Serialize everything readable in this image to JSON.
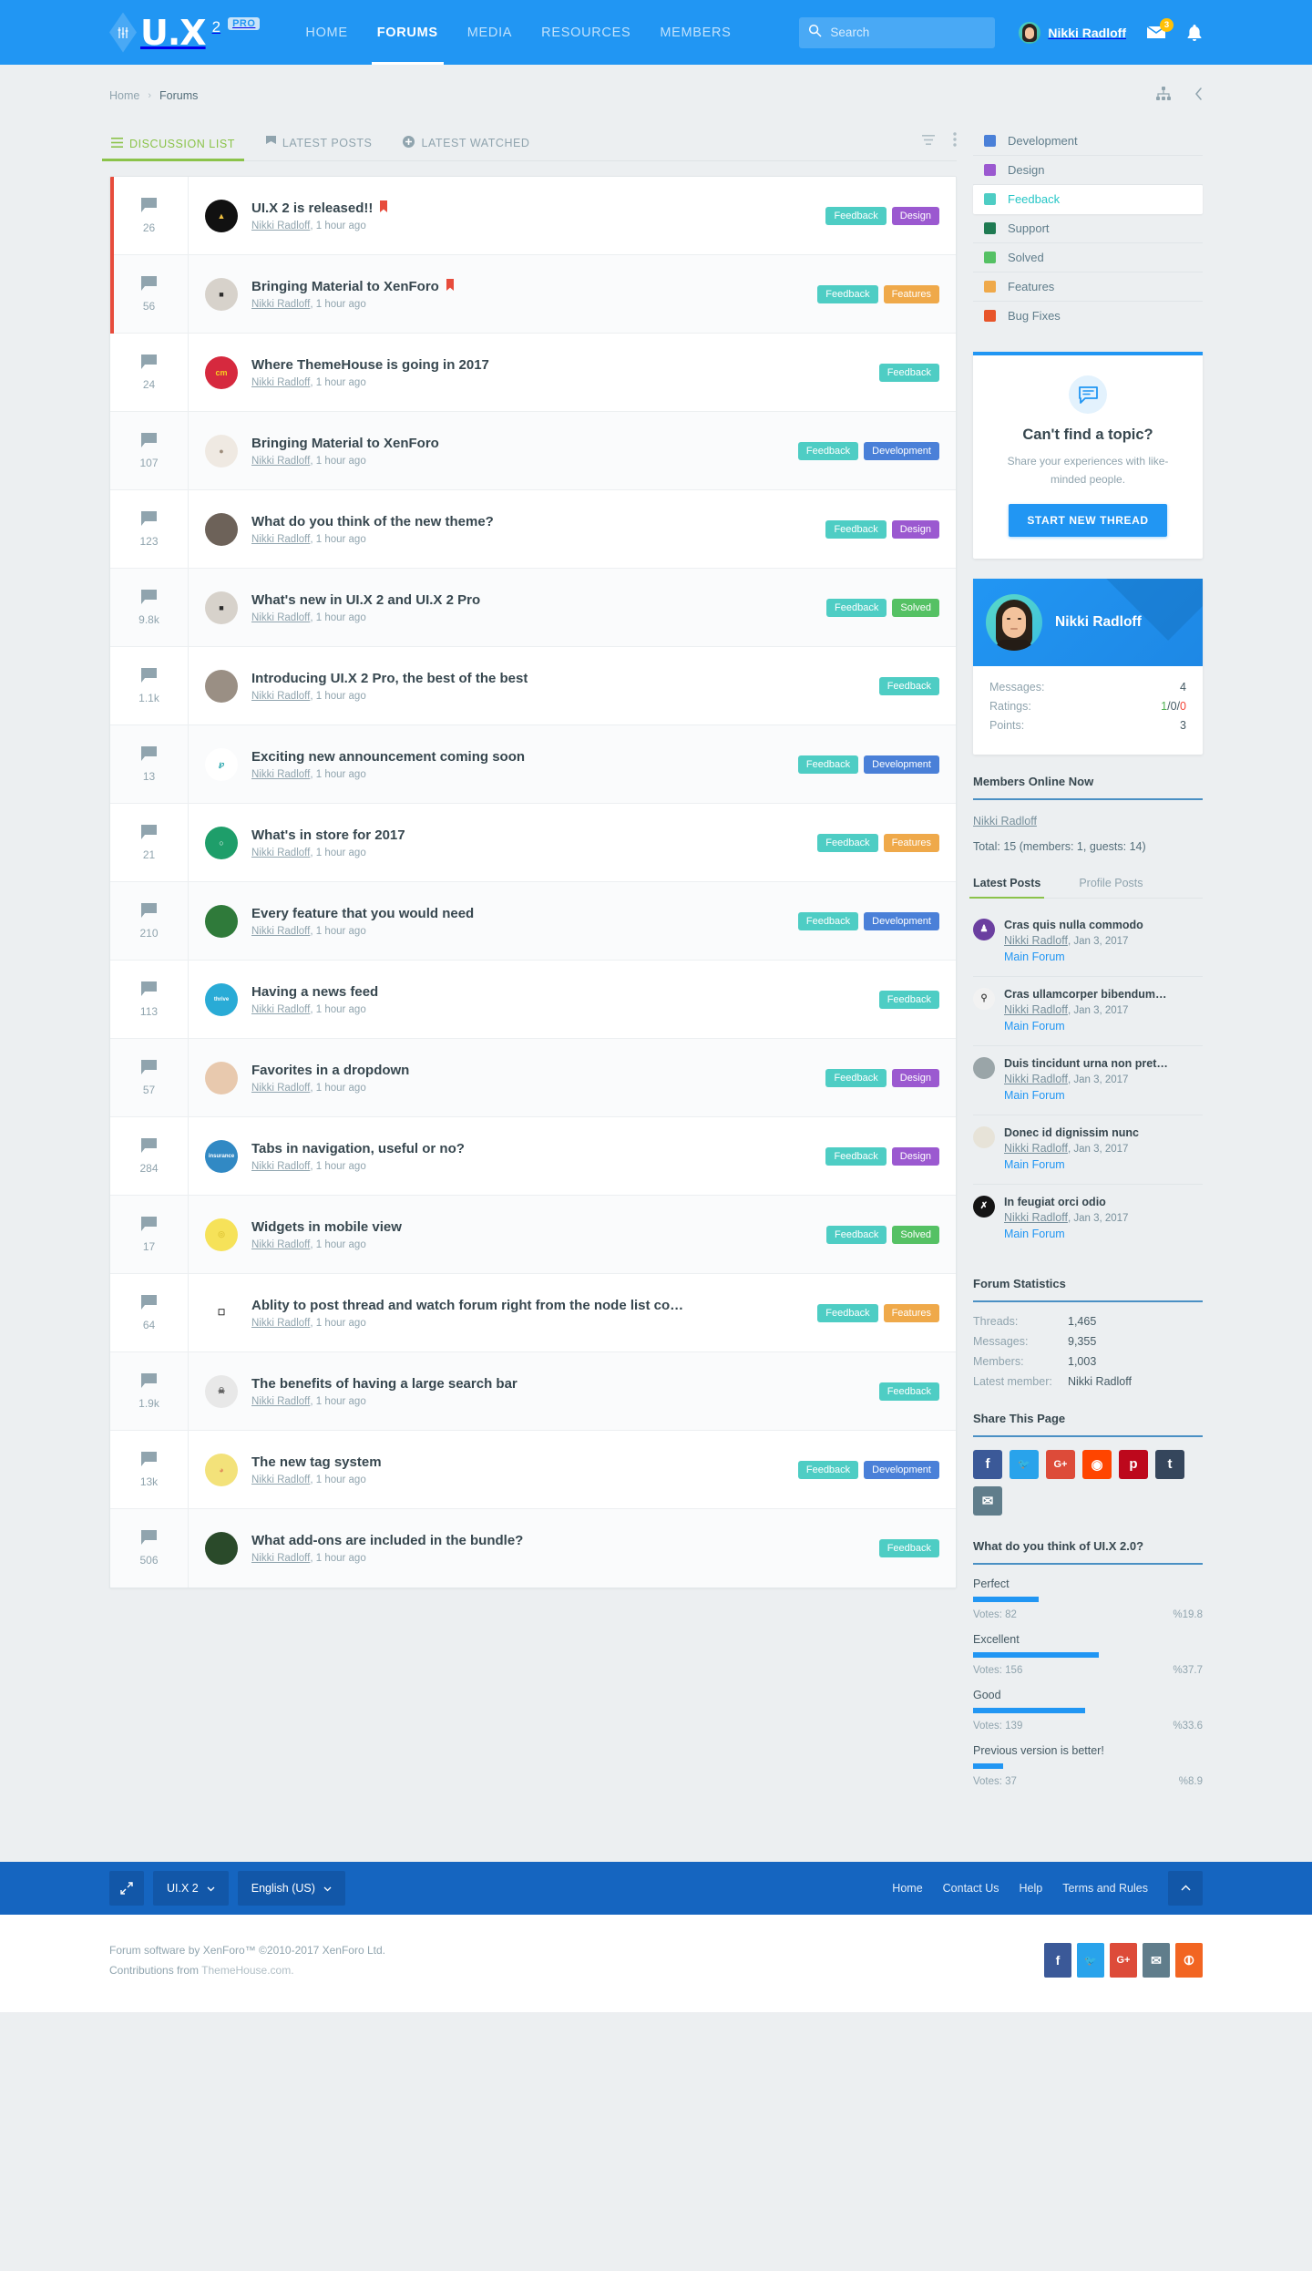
{
  "header": {
    "logo_text": "U.X",
    "logo_version": "2",
    "logo_badge": "PRO",
    "nav": [
      {
        "label": "HOME",
        "active": false
      },
      {
        "label": "FORUMS",
        "active": true
      },
      {
        "label": "MEDIA",
        "active": false
      },
      {
        "label": "RESOURCES",
        "active": false
      },
      {
        "label": "MEMBERS",
        "active": false
      }
    ],
    "search_placeholder": "Search",
    "search_value": "",
    "username": "Nikki Radloff",
    "inbox_badge": "3"
  },
  "breadcrumb": {
    "home": "Home",
    "separator": "›",
    "current": "Forums"
  },
  "tabs": [
    {
      "label": "DISCUSSION LIST",
      "icon": "list-icon",
      "active": true
    },
    {
      "label": "LATEST POSTS",
      "icon": "flag-icon",
      "active": false
    },
    {
      "label": "LATEST WATCHED",
      "icon": "plus-circle-icon",
      "active": false
    }
  ],
  "threads": [
    {
      "count": "26",
      "title": "UI.X 2 is released!!",
      "author": "Nikki Radloff",
      "time": "1 hour ago",
      "sticky": true,
      "pinned": true,
      "tags": [
        {
          "label": "Feedback",
          "color": "#4ecdc4"
        },
        {
          "label": "Design",
          "color": "#9b59d0"
        }
      ],
      "avatar": {
        "bg": "#111111",
        "fg": "#f0c040",
        "letter": "▲"
      }
    },
    {
      "count": "56",
      "title": "Bringing Material to XenForo",
      "author": "Nikki Radloff",
      "time": "1 hour ago",
      "sticky": true,
      "pinned": true,
      "tags": [
        {
          "label": "Feedback",
          "color": "#4ecdc4"
        },
        {
          "label": "Features",
          "color": "#efa94a"
        }
      ],
      "avatar": {
        "bg": "#d7d2cb",
        "fg": "#2b2b2b",
        "letter": "■"
      }
    },
    {
      "count": "24",
      "title": "Where ThemeHouse is going in 2017",
      "author": "Nikki Radloff",
      "time": "1 hour ago",
      "sticky": false,
      "pinned": false,
      "tags": [
        {
          "label": "Feedback",
          "color": "#4ecdc4"
        }
      ],
      "avatar": {
        "bg": "#d6293e",
        "fg": "#f5d020",
        "letter": "cm"
      }
    },
    {
      "count": "107",
      "title": "Bringing Material to XenForo",
      "author": "Nikki Radloff",
      "time": "1 hour ago",
      "sticky": false,
      "pinned": false,
      "tags": [
        {
          "label": "Feedback",
          "color": "#4ecdc4"
        },
        {
          "label": "Development",
          "color": "#4a80d8"
        }
      ],
      "avatar": {
        "bg": "#efe9e2",
        "fg": "#9e8d7c",
        "letter": "●"
      }
    },
    {
      "count": "123",
      "title": "What do you think of the new theme?",
      "author": "Nikki Radloff",
      "time": "1 hour ago",
      "sticky": false,
      "pinned": false,
      "tags": [
        {
          "label": "Feedback",
          "color": "#4ecdc4"
        },
        {
          "label": "Design",
          "color": "#9b59d0"
        }
      ],
      "avatar": {
        "bg": "#6d6259",
        "fg": "#ffffff",
        "letter": ""
      }
    },
    {
      "count": "9.8k",
      "title": "What's new in UI.X 2 and UI.X 2 Pro",
      "author": "Nikki Radloff",
      "time": "1 hour ago",
      "sticky": false,
      "pinned": false,
      "tags": [
        {
          "label": "Feedback",
          "color": "#4ecdc4"
        },
        {
          "label": "Solved",
          "color": "#55c164"
        }
      ],
      "avatar": {
        "bg": "#d7d2cb",
        "fg": "#2b2b2b",
        "letter": "■"
      }
    },
    {
      "count": "1.1k",
      "title": "Introducing UI.X 2 Pro, the best of the best",
      "author": "Nikki Radloff",
      "time": "1 hour ago",
      "sticky": false,
      "pinned": false,
      "tags": [
        {
          "label": "Feedback",
          "color": "#4ecdc4"
        }
      ],
      "avatar": {
        "bg": "#9a8f84",
        "fg": "#3a3129",
        "letter": ""
      }
    },
    {
      "count": "13",
      "title": "Exciting new announcement coming soon",
      "author": "Nikki Radloff",
      "time": "1 hour ago",
      "sticky": false,
      "pinned": false,
      "tags": [
        {
          "label": "Feedback",
          "color": "#4ecdc4"
        },
        {
          "label": "Development",
          "color": "#4a80d8"
        }
      ],
      "avatar": {
        "bg": "#ffffff",
        "fg": "#1ba0a8",
        "letter": "℘"
      }
    },
    {
      "count": "21",
      "title": "What's in store for 2017",
      "author": "Nikki Radloff",
      "time": "1 hour ago",
      "sticky": false,
      "pinned": false,
      "tags": [
        {
          "label": "Feedback",
          "color": "#4ecdc4"
        },
        {
          "label": "Features",
          "color": "#efa94a"
        }
      ],
      "avatar": {
        "bg": "#1e9e6a",
        "fg": "#ffffff",
        "letter": "○"
      }
    },
    {
      "count": "210",
      "title": "Every feature that you would need",
      "author": "Nikki Radloff",
      "time": "1 hour ago",
      "sticky": false,
      "pinned": false,
      "tags": [
        {
          "label": "Feedback",
          "color": "#4ecdc4"
        },
        {
          "label": "Development",
          "color": "#4a80d8"
        }
      ],
      "avatar": {
        "bg": "#2f7a3a",
        "fg": "#e8d24a",
        "letter": ""
      }
    },
    {
      "count": "113",
      "title": "Having a news feed",
      "author": "Nikki Radloff",
      "time": "1 hour ago",
      "sticky": false,
      "pinned": false,
      "tags": [
        {
          "label": "Feedback",
          "color": "#4ecdc4"
        }
      ],
      "avatar": {
        "bg": "#29abd6",
        "fg": "#ffffff",
        "letter": "thrive"
      }
    },
    {
      "count": "57",
      "title": "Favorites in a dropdown",
      "author": "Nikki Radloff",
      "time": "1 hour ago",
      "sticky": false,
      "pinned": false,
      "tags": [
        {
          "label": "Feedback",
          "color": "#4ecdc4"
        },
        {
          "label": "Design",
          "color": "#9b59d0"
        }
      ],
      "avatar": {
        "bg": "#e8c9ae",
        "fg": "#6b4a33",
        "letter": ""
      }
    },
    {
      "count": "284",
      "title": "Tabs in navigation, useful or no?",
      "author": "Nikki Radloff",
      "time": "1 hour ago",
      "sticky": false,
      "pinned": false,
      "tags": [
        {
          "label": "Feedback",
          "color": "#4ecdc4"
        },
        {
          "label": "Design",
          "color": "#9b59d0"
        }
      ],
      "avatar": {
        "bg": "#3189c4",
        "fg": "#ffffff",
        "letter": "insurance"
      }
    },
    {
      "count": "17",
      "title": "Widgets in mobile view",
      "author": "Nikki Radloff",
      "time": "1 hour ago",
      "sticky": false,
      "pinned": false,
      "tags": [
        {
          "label": "Feedback",
          "color": "#4ecdc4"
        },
        {
          "label": "Solved",
          "color": "#55c164"
        }
      ],
      "avatar": {
        "bg": "#f6e259",
        "fg": "#e2c93a",
        "letter": "◎"
      }
    },
    {
      "count": "64",
      "title": "Ablity to post thread and watch forum right from the node list co…",
      "author": "Nikki Radloff",
      "time": "1 hour ago",
      "sticky": false,
      "pinned": false,
      "tags": [
        {
          "label": "Feedback",
          "color": "#4ecdc4"
        },
        {
          "label": "Features",
          "color": "#efa94a"
        }
      ],
      "avatar": {
        "bg": "#ffffff",
        "fg": "#111111",
        "letter": "☐"
      }
    },
    {
      "count": "1.9k",
      "title": "The benefits of having a large search bar",
      "author": "Nikki Radloff",
      "time": "1 hour ago",
      "sticky": false,
      "pinned": false,
      "tags": [
        {
          "label": "Feedback",
          "color": "#4ecdc4"
        }
      ],
      "avatar": {
        "bg": "#e8e8e8",
        "fg": "#555555",
        "letter": "☠"
      }
    },
    {
      "count": "13k",
      "title": "The new tag system",
      "author": "Nikki Radloff",
      "time": "1 hour ago",
      "sticky": false,
      "pinned": false,
      "tags": [
        {
          "label": "Feedback",
          "color": "#4ecdc4"
        },
        {
          "label": "Development",
          "color": "#4a80d8"
        }
      ],
      "avatar": {
        "bg": "#f3e27a",
        "fg": "#e08a5a",
        "letter": "◕"
      }
    },
    {
      "count": "506",
      "title": "What add-ons are included in the bundle?",
      "author": "Nikki Radloff",
      "time": "1 hour ago",
      "sticky": false,
      "pinned": false,
      "tags": [
        {
          "label": "Feedback",
          "color": "#4ecdc4"
        }
      ],
      "avatar": {
        "bg": "#2a4a2a",
        "fg": "#d8c06a",
        "letter": ""
      }
    }
  ],
  "categories": [
    {
      "label": "Development",
      "color": "#4a80d8",
      "active": false
    },
    {
      "label": "Design",
      "color": "#9b59d0",
      "active": false
    },
    {
      "label": "Feedback",
      "color": "#4ecdc4",
      "active": true
    },
    {
      "label": "Support",
      "color": "#1e7a52",
      "active": false
    },
    {
      "label": "Solved",
      "color": "#55c164",
      "active": false
    },
    {
      "label": "Features",
      "color": "#efa94a",
      "active": false
    },
    {
      "label": "Bug Fixes",
      "color": "#e8552a",
      "active": false
    }
  ],
  "cta": {
    "title": "Can't find a topic?",
    "text": "Share your experiences with like-minded people.",
    "button": "START NEW THREAD"
  },
  "profile": {
    "name": "Nikki Radloff",
    "rows": [
      {
        "key": "Messages:",
        "value": "4"
      },
      {
        "key": "Ratings:",
        "value": "1/0/0"
      },
      {
        "key": "Points:",
        "value": "3"
      }
    ],
    "ratings": {
      "positive": "1",
      "neutral": "0",
      "negative": "0"
    }
  },
  "members_online": {
    "title": "Members Online Now",
    "members": [
      "Nikki Radloff"
    ],
    "total": "Total: 15 (members: 1, guests: 14)"
  },
  "side_tabs": [
    {
      "label": "Latest Posts",
      "active": true
    },
    {
      "label": "Profile Posts",
      "active": false
    }
  ],
  "latest_posts": [
    {
      "title": "Cras quis nulla commodo",
      "author": "Nikki Radloff",
      "date": "Jan 3, 2017",
      "forum": "Main Forum",
      "avatar": {
        "bg": "#6b3fa0",
        "fg": "#ffffff",
        "letter": "♟"
      }
    },
    {
      "title": "Cras ullamcorper bibendum…",
      "author": "Nikki Radloff",
      "date": "Jan 3, 2017",
      "forum": "Main Forum",
      "avatar": {
        "bg": "#f2f2f2",
        "fg": "#4a4a4a",
        "letter": "⚲"
      }
    },
    {
      "title": "Duis tincidunt urna non pret…",
      "author": "Nikki Radloff",
      "date": "Jan 3, 2017",
      "forum": "Main Forum",
      "avatar": {
        "bg": "#9aa5a8",
        "fg": "#ffffff",
        "letter": ""
      }
    },
    {
      "title": "Donec id dignissim nunc",
      "author": "Nikki Radloff",
      "date": "Jan 3, 2017",
      "forum": "Main Forum",
      "avatar": {
        "bg": "#e7e3d8",
        "fg": "#3a5c3a",
        "letter": ""
      }
    },
    {
      "title": " In feugiat orci odio",
      "author": "Nikki Radloff",
      "date": "Jan 3, 2017",
      "forum": "Main Forum",
      "avatar": {
        "bg": "#141414",
        "fg": "#ffffff",
        "letter": "✗"
      }
    }
  ],
  "forum_statistics": {
    "title": "Forum Statistics",
    "rows": [
      {
        "key": "Threads:",
        "value": "1,465"
      },
      {
        "key": "Messages:",
        "value": "9,355"
      },
      {
        "key": "Members:",
        "value": "1,003"
      },
      {
        "key": "Latest member:",
        "value": "Nikki Radloff"
      }
    ]
  },
  "share": {
    "title": "Share This Page",
    "buttons": [
      {
        "name": "facebook",
        "glyph": "f",
        "color": "#3b5998"
      },
      {
        "name": "twitter",
        "glyph": "🐦",
        "color": "#29a3eb"
      },
      {
        "name": "google-plus",
        "glyph": "G+",
        "color": "#dd4b39"
      },
      {
        "name": "reddit",
        "glyph": "◉",
        "color": "#ff4500"
      },
      {
        "name": "pinterest",
        "glyph": "р",
        "color": "#bd081c"
      },
      {
        "name": "tumblr",
        "glyph": "t",
        "color": "#35465c"
      },
      {
        "name": "email",
        "glyph": "✉",
        "color": "#607d8b"
      }
    ]
  },
  "poll": {
    "title": "What do you think of UI.X 2.0?",
    "options": [
      {
        "label": "Perfect",
        "votes": "Votes: 82",
        "percent": "%19.8",
        "width": 19.8
      },
      {
        "label": "Excellent",
        "votes": "Votes: 156",
        "percent": "%37.7",
        "width": 37.7
      },
      {
        "label": "Good",
        "votes": "Votes: 139",
        "percent": "%33.6",
        "width": 33.6
      },
      {
        "label": "Previous version is better!",
        "votes": "Votes: 37",
        "percent": "%8.9",
        "width": 8.9
      }
    ]
  },
  "footer": {
    "style_label": "UI.X 2",
    "language_label": "English (US)",
    "links": [
      "Home",
      "Contact Us",
      "Help",
      "Terms and Rules"
    ],
    "copyright_line1": "Forum software by XenForo™ ©2010-2017 XenForo Ltd.",
    "contrib_prefix": "Contributions from ",
    "contrib_link": "ThemeHouse.com.",
    "social": [
      {
        "name": "facebook",
        "glyph": "f",
        "color": "#3b5998"
      },
      {
        "name": "twitter",
        "glyph": "🐦",
        "color": "#29a3eb"
      },
      {
        "name": "google-plus",
        "glyph": "G+",
        "color": "#dd4b39"
      },
      {
        "name": "email",
        "glyph": "✉",
        "color": "#607d8b"
      },
      {
        "name": "rss",
        "glyph": "⦷",
        "color": "#f26522"
      }
    ]
  },
  "colors": {
    "brand": "#2196f3",
    "accent_green": "#8bc34a",
    "sticky": "#e74c3c",
    "page_bg": "#eceff1"
  }
}
